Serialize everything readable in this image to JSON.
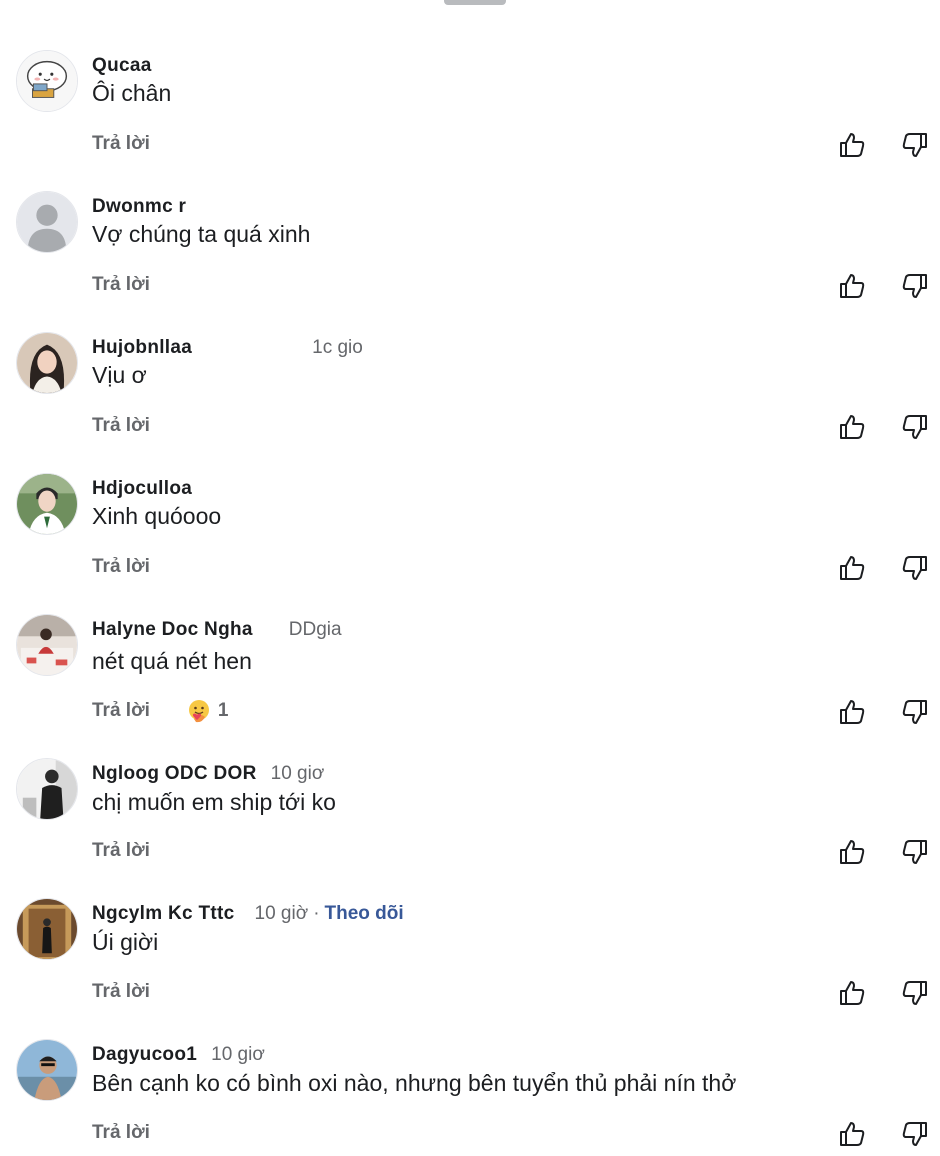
{
  "reply_label": "Trả lời",
  "icons": {
    "like": "thumbs-up-icon",
    "dislike": "thumbs-down-icon",
    "care": "care-reaction-icon"
  },
  "colors": {
    "text": "#1c1e21",
    "muted": "#65676b",
    "link": "#385898"
  },
  "comments": [
    {
      "author": "Qucaa",
      "time": "",
      "text": "Ôi chân",
      "avatar": "cartoon-avatar",
      "follow": "",
      "reaction_count": ""
    },
    {
      "author": "Dwonmc r",
      "time": "",
      "text": "Vợ chúng ta quá xinh",
      "avatar": "default-avatar",
      "follow": "",
      "reaction_count": ""
    },
    {
      "author": "Hujobnllaa",
      "time": "1c gio",
      "text": "Vịu ơ",
      "avatar": "photo-avatar",
      "follow": "",
      "reaction_count": ""
    },
    {
      "author": "Hdjoculloa",
      "time": "",
      "text": "Xinh quóooo",
      "avatar": "photo-avatar",
      "follow": "",
      "reaction_count": ""
    },
    {
      "author": "Halyne Doc Ngha",
      "time": "DDgia",
      "text": "nét quá nét hen",
      "avatar": "photo-avatar",
      "follow": "",
      "reaction_count": "1"
    },
    {
      "author": "Ngloog ODC DOR",
      "time": "10 giơ",
      "text": "chị muốn em ship tới ko",
      "avatar": "photo-avatar",
      "follow": "",
      "reaction_count": ""
    },
    {
      "author": "Ngcylm Kc Tttc",
      "time": "10 giờ",
      "text": "Úi giời",
      "avatar": "photo-avatar",
      "follow": "Theo dõi",
      "reaction_count": ""
    },
    {
      "author": "Dagyucoo1",
      "time": "10 giơ",
      "text": "Bên cạnh ko có bình oxi nào, nhưng bên tuyển thủ phải nín thở",
      "avatar": "photo-avatar",
      "follow": "",
      "reaction_count": ""
    }
  ]
}
